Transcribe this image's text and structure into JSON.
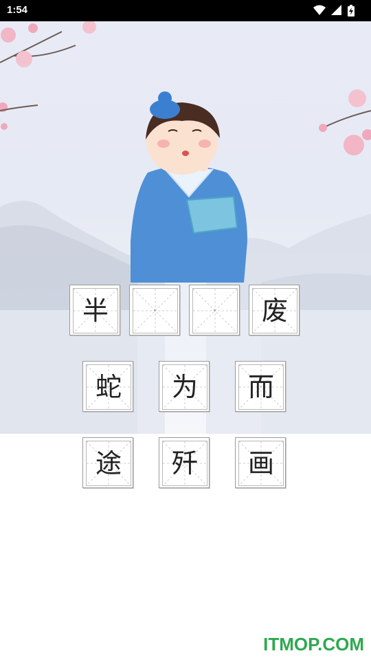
{
  "status_bar": {
    "time": "1:54",
    "icons": [
      "wifi-icon",
      "signal-icon",
      "battery-charging-icon"
    ]
  },
  "puzzle": {
    "answer_slots": [
      {
        "char": "半",
        "filled": true
      },
      {
        "char": "",
        "filled": false
      },
      {
        "char": "",
        "filled": false
      },
      {
        "char": "废",
        "filled": true
      }
    ],
    "candidate_rows": [
      [
        "蛇",
        "为",
        "而"
      ],
      [
        "途",
        "歼",
        "画"
      ]
    ]
  },
  "watermark": "ITMOP.COM",
  "colors": {
    "robe": "#4f8fd6",
    "blossom": "#f2b6c6",
    "watermark": "#2fa84f"
  }
}
